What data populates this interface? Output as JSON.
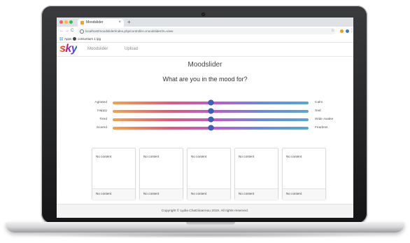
{
  "browser": {
    "tab_title": "Moodslider",
    "tab_close": "×",
    "new_tab": "+",
    "nav_back": "←",
    "nav_forward": "→",
    "nav_reload": "C",
    "url": "localhost/moodslider/index.php/controller=moodslider/m=view",
    "star": "☆",
    "menu": "⋮",
    "bookmarks": [
      {
        "label": "Apps"
      },
      {
        "label": "consortium 1 ipg"
      }
    ]
  },
  "header": {
    "logo": "sky",
    "nav": [
      {
        "label": "Moodslider"
      },
      {
        "label": "Upload"
      }
    ]
  },
  "main": {
    "title": "Moodslider",
    "question": "What are you in the mood for?"
  },
  "sliders": [
    {
      "left": "Agitated",
      "right": "Calm",
      "value": 0.5
    },
    {
      "left": "Happy",
      "right": "Sad",
      "value": 0.5
    },
    {
      "left": "Tired",
      "right": "Wide Awake",
      "value": 0.5
    },
    {
      "left": "Scared",
      "right": "Fearless",
      "value": 0.5
    }
  ],
  "cards": [
    {
      "body": "No content",
      "footer": "No content"
    },
    {
      "body": "No content",
      "footer": "No content"
    },
    {
      "body": "No content",
      "footer": "No content"
    },
    {
      "body": "No content",
      "footer": "No content"
    },
    {
      "body": "No content",
      "footer": "No content"
    }
  ],
  "footer": {
    "copyright": "Copyright © Lydia Chatziioannou 2019. All rights reserved."
  },
  "colors": {
    "track_start": "#f6a14a",
    "track_mid": "#ea5479",
    "track_end": "#58a6d8",
    "thumb": "#3c5fc4"
  }
}
